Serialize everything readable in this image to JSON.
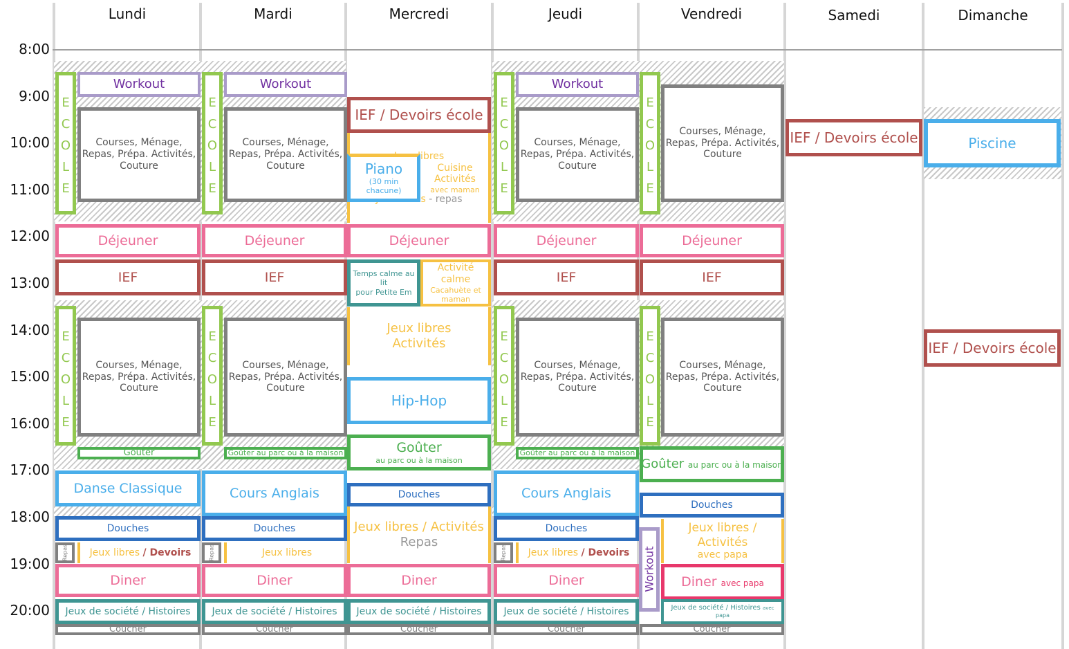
{
  "colors": {
    "school": "#92c84f",
    "workout": "#a99bc9",
    "workoutText": "#7030a0",
    "chores": "#808080",
    "choresText": "#555555",
    "ief": "#b0504d",
    "meal": "#ec6c97",
    "free": "#f6c142",
    "swim": "#4aaeea",
    "calm": "#3f9592",
    "snack": "#4caf50",
    "shower": "#2e6fbf",
    "papa": "#e8386b",
    "bed": "#808080",
    "grey": "#999999"
  },
  "days": [
    "Lundi",
    "Mardi",
    "Mercredi",
    "Jeudi",
    "Vendredi",
    "Samedi",
    "Dimanche"
  ],
  "times": [
    "8:00",
    "9:00",
    "10:00",
    "11:00",
    "12:00",
    "13:00",
    "14:00",
    "15:00",
    "16:00",
    "17:00",
    "18:00",
    "19:00",
    "20:00"
  ],
  "schedule": {
    "Lundi": [
      {
        "lines": [
          "ECOLE"
        ],
        "color": "school"
      },
      {
        "lines": [
          "Workout"
        ],
        "color": "workout",
        "text": "workoutText"
      },
      {
        "lines": [
          "Courses, Ménage,",
          "Repas, Prépa. Activités,",
          "Couture"
        ],
        "color": "chores",
        "text": "choresText"
      },
      {
        "lines": [
          "Déjeuner"
        ],
        "color": "meal"
      },
      {
        "lines": [
          "IEF"
        ],
        "color": "ief"
      },
      {
        "lines": [
          "ECOLE"
        ],
        "color": "school"
      },
      {
        "lines": [
          "Courses, Ménage,",
          "Repas, Prépa. Activités,",
          "Couture"
        ],
        "color": "chores",
        "text": "choresText"
      },
      {
        "lines": [
          "Goûter"
        ],
        "color": "snack"
      },
      {
        "lines": [
          "Danse Classique"
        ],
        "color": "swim"
      },
      {
        "lines": [
          "Douches"
        ],
        "color": "shower"
      },
      {
        "lines": [
          "Repas"
        ],
        "color": "bed"
      },
      {
        "lines": [
          [
            [
              "Jeux libres ",
              "free"
            ],
            [
              "/ Devoirs",
              "ief"
            ]
          ]
        ],
        "color": "free"
      },
      {
        "lines": [
          "Diner"
        ],
        "color": "meal"
      },
      {
        "lines": [
          "Jeux de société / Histoires"
        ],
        "color": "calm"
      },
      {
        "lines": [
          "Coucher"
        ],
        "color": "bed"
      }
    ],
    "Mardi": [
      {
        "lines": [
          "ECOLE"
        ],
        "color": "school"
      },
      {
        "lines": [
          "Workout"
        ],
        "color": "workout",
        "text": "workoutText"
      },
      {
        "lines": [
          "Courses, Ménage,",
          "Repas, Prépa. Activités,",
          "Couture"
        ],
        "color": "chores",
        "text": "choresText"
      },
      {
        "lines": [
          "Déjeuner"
        ],
        "color": "meal"
      },
      {
        "lines": [
          "IEF"
        ],
        "color": "ief"
      },
      {
        "lines": [
          "ECOLE"
        ],
        "color": "school"
      },
      {
        "lines": [
          "Courses, Ménage,",
          "Repas, Prépa. Activités,",
          "Couture"
        ],
        "color": "chores",
        "text": "choresText"
      },
      {
        "lines": [
          "Goûter au parc ou à la maison"
        ],
        "color": "snack"
      },
      {
        "lines": [
          "Cours Anglais"
        ],
        "color": "swim"
      },
      {
        "lines": [
          "Douches"
        ],
        "color": "shower"
      },
      {
        "lines": [
          "Repas"
        ],
        "color": "bed"
      },
      {
        "lines": [
          "Jeux libres"
        ],
        "color": "free"
      },
      {
        "lines": [
          "Diner"
        ],
        "color": "meal"
      },
      {
        "lines": [
          "Jeux de société / Histoires"
        ],
        "color": "calm"
      },
      {
        "lines": [
          "Coucher"
        ],
        "color": "bed"
      }
    ],
    "Mercredi": [
      {
        "lines": [
          "IEF / Devoirs école"
        ],
        "color": "ief"
      },
      {
        "lines": [
          "Jeux libres",
          "",
          "",
          " ",
          "",
          "",
          [
            [
              "Jeux libres ",
              "free"
            ],
            [
              "- repas",
              "grey"
            ]
          ]
        ],
        "color": "free"
      },
      {
        "lines": [
          "Piano",
          "(30 min chacune)"
        ],
        "color": "swim"
      },
      {
        "lines": [
          "Cuisine",
          "Activités",
          "avec maman"
        ],
        "color": "none",
        "text": "free"
      },
      {
        "lines": [
          "Déjeuner"
        ],
        "color": "meal"
      },
      {
        "lines": [
          "Temps calme au lit",
          "pour Petite Em"
        ],
        "color": "calm"
      },
      {
        "lines": [
          "Activité calme",
          "Cacahuète et",
          "maman"
        ],
        "color": "free"
      },
      {
        "lines": [
          "Jeux libres",
          "Activités"
        ],
        "color": "free"
      },
      {
        "lines": [
          "Hip-Hop"
        ],
        "color": "swim"
      },
      {
        "lines": [
          "Goûter",
          "au parc ou à la maison"
        ],
        "color": "snack"
      },
      {
        "lines": [
          "Douches"
        ],
        "color": "shower"
      },
      {
        "lines": [
          "Jeux libres / Activités",
          [
            [
              "Repas",
              "grey"
            ]
          ]
        ],
        "color": "free"
      },
      {
        "lines": [
          "Diner"
        ],
        "color": "meal"
      },
      {
        "lines": [
          "Jeux de société / Histoires"
        ],
        "color": "calm"
      },
      {
        "lines": [
          "Coucher"
        ],
        "color": "bed"
      }
    ],
    "Jeudi": [
      {
        "lines": [
          "ECOLE"
        ],
        "color": "school"
      },
      {
        "lines": [
          "Workout"
        ],
        "color": "workout",
        "text": "workoutText"
      },
      {
        "lines": [
          "Courses, Ménage,",
          "Repas, Prépa. Activités,",
          "Couture"
        ],
        "color": "chores",
        "text": "choresText"
      },
      {
        "lines": [
          "Déjeuner"
        ],
        "color": "meal"
      },
      {
        "lines": [
          "IEF"
        ],
        "color": "ief"
      },
      {
        "lines": [
          "ECOLE"
        ],
        "color": "school"
      },
      {
        "lines": [
          "Courses, Ménage,",
          "Repas, Prépa. Activités,",
          "Couture"
        ],
        "color": "chores",
        "text": "choresText"
      },
      {
        "lines": [
          "Goûter au parc ou à la maison"
        ],
        "color": "snack"
      },
      {
        "lines": [
          "Cours Anglais"
        ],
        "color": "swim"
      },
      {
        "lines": [
          "Douches"
        ],
        "color": "shower"
      },
      {
        "lines": [
          "Repas"
        ],
        "color": "bed"
      },
      {
        "lines": [
          [
            [
              "Jeux libres ",
              "free"
            ],
            [
              "/ Devoirs",
              "ief"
            ]
          ]
        ],
        "color": "free"
      },
      {
        "lines": [
          "Diner"
        ],
        "color": "meal"
      },
      {
        "lines": [
          "Jeux de société / Histoires"
        ],
        "color": "calm"
      },
      {
        "lines": [
          "Coucher"
        ],
        "color": "bed"
      }
    ],
    "Vendredi": [
      {
        "lines": [
          "ECOLE"
        ],
        "color": "school"
      },
      {
        "lines": [
          "Courses, Ménage,",
          "Repas, Prépa. Activités,",
          "Couture"
        ],
        "color": "chores",
        "text": "choresText"
      },
      {
        "lines": [
          "Déjeuner"
        ],
        "color": "meal"
      },
      {
        "lines": [
          "IEF"
        ],
        "color": "ief"
      },
      {
        "lines": [
          "ECOLE"
        ],
        "color": "school"
      },
      {
        "lines": [
          "Courses, Ménage,",
          "Repas, Prépa. Activités,",
          "Couture"
        ],
        "color": "chores",
        "text": "choresText"
      },
      {
        "lines": [
          [
            [
              "Goûter ",
              "snack"
            ],
            [
              "au parc ou à la maison",
              "snack"
            ]
          ]
        ],
        "color": "snack"
      },
      {
        "lines": [
          "Douches"
        ],
        "color": "shower"
      },
      {
        "lines": [
          "Workout"
        ],
        "color": "workout",
        "text": "workoutText"
      },
      {
        "lines": [
          "Jeux libres / Activités",
          "avec papa"
        ],
        "color": "free"
      },
      {
        "lines": [
          [
            [
              "Diner ",
              "meal"
            ],
            [
              "avec papa",
              "papa"
            ]
          ]
        ],
        "color": "papa",
        "text": "meal"
      },
      {
        "lines": [
          [
            [
              "Jeux de société / Histoires ",
              "calm"
            ],
            [
              "avec",
              "calm"
            ]
          ],
          "papa"
        ],
        "color": "calm"
      },
      {
        "lines": [
          "Coucher"
        ],
        "color": "bed"
      }
    ],
    "Samedi": [
      {
        "lines": [
          "IEF / Devoirs école"
        ],
        "color": "ief"
      }
    ],
    "Dimanche": [
      {
        "lines": [
          "Piscine"
        ],
        "color": "swim"
      },
      {
        "lines": [
          "IEF / Devoirs école"
        ],
        "color": "ief"
      }
    ]
  }
}
